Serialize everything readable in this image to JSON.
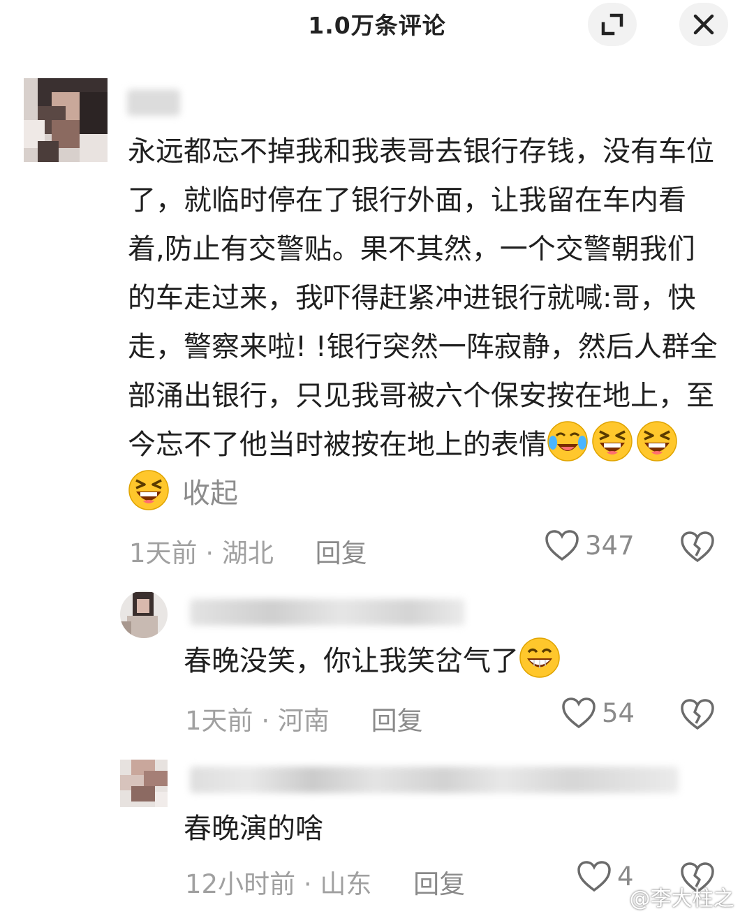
{
  "header": {
    "title": "1.0万条评论",
    "expand_icon": "expand-icon",
    "close_icon": "close-icon"
  },
  "comments": [
    {
      "text": "永远都忘不掉我和我表哥去银行存钱，没有车位了，就临时停在了银行外面，让我留在车内看着,防止有交警贴。果不其然，一个交警朝我们的车走过来，我吓得赶紧冲进银行就喊:哥，快走，警察来啦! !银行突然一阵寂静，然后人群全部涌出银行，只见我哥被六个保安按在地上，至今忘不了他当时被按在地上的表情",
      "emojis": [
        "crying-laugh-emoji",
        "laughing-emoji",
        "laughing-emoji",
        "laughing-emoji"
      ],
      "collapse_label": "收起",
      "time": "1天前",
      "separator": "·",
      "location": "湖北",
      "reply_label": "回复",
      "likes": "347"
    },
    {
      "text": "春晚没笑，你让我笑岔气了",
      "emojis": [
        "grin-emoji"
      ],
      "time": "1天前",
      "separator": "·",
      "location": "河南",
      "reply_label": "回复",
      "likes": "54"
    },
    {
      "text": "春晚演的啥",
      "time": "12小时前",
      "separator": "·",
      "location": "山东",
      "reply_label": "回复",
      "likes": "4"
    }
  ],
  "watermark": "@李大柱之冠",
  "colors": {
    "text": "#1f1f1f",
    "meta": "#a0a0a0",
    "header_button_bg": "#f2f2f2",
    "emoji_yellow": "#ffc72c"
  }
}
